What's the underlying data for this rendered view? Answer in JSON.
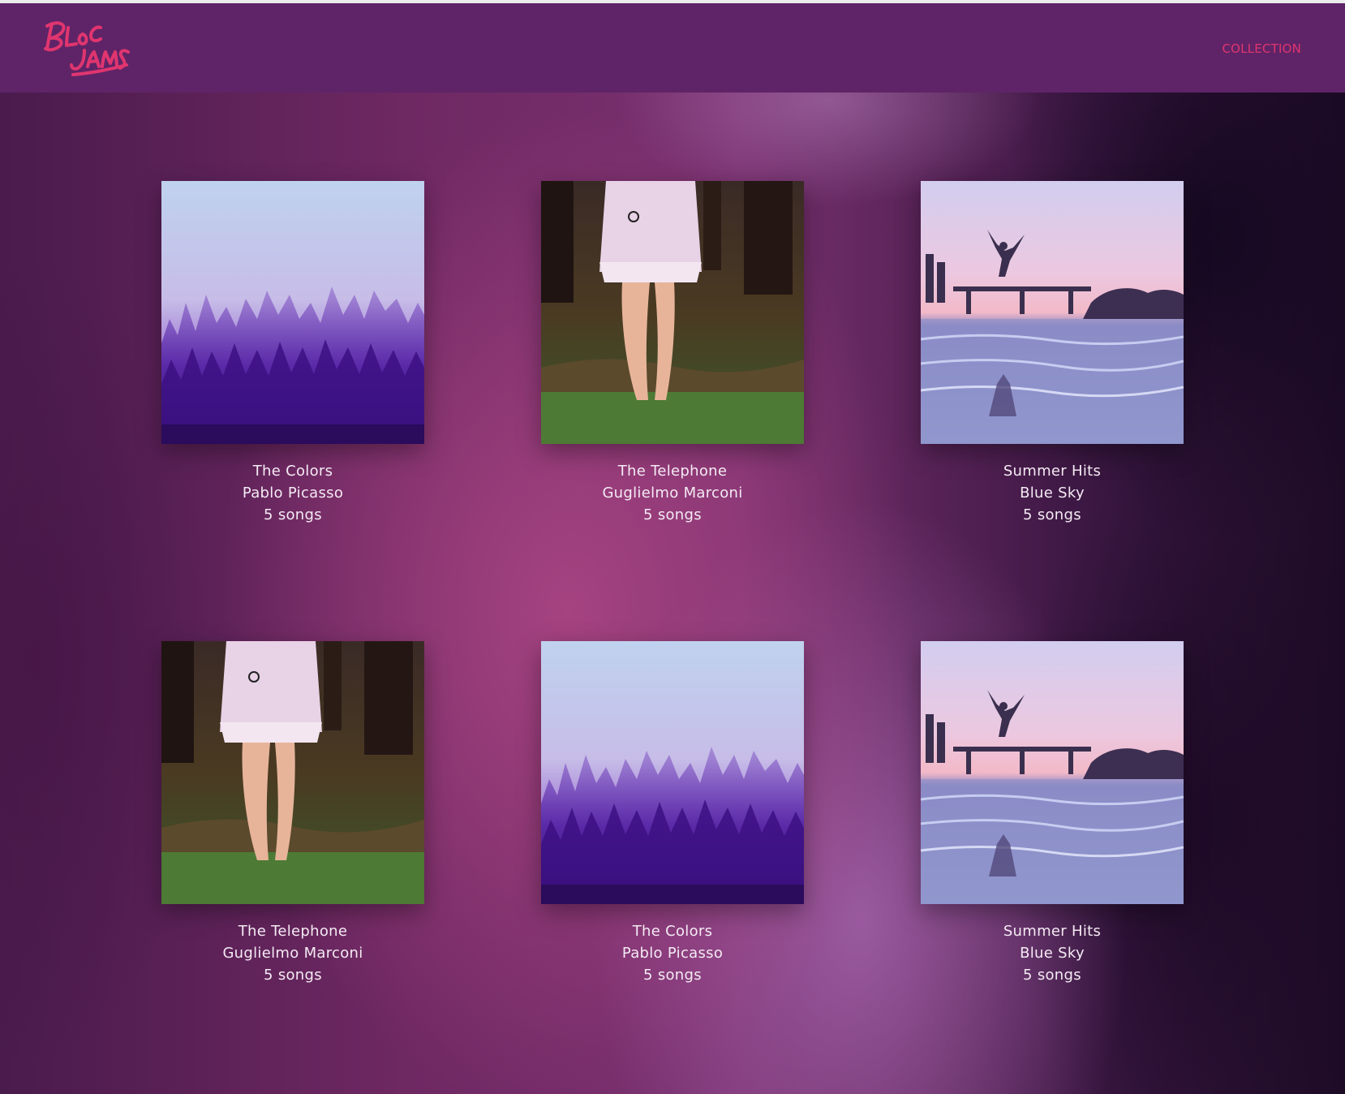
{
  "header": {
    "logo_alt": "Bloc Jams",
    "nav": {
      "collection_label": "COLLECTION"
    }
  },
  "colors": {
    "navbar": "#5f2467",
    "accent": "#e0356f",
    "text": "#f4eaf3"
  },
  "albums": [
    {
      "title": "The Colors",
      "artist": "Pablo Picasso",
      "songs": "5 songs",
      "cover": "foggy-forest-cover"
    },
    {
      "title": "The Telephone",
      "artist": "Guglielmo Marconi",
      "songs": "5 songs",
      "cover": "girl-in-dress-cover"
    },
    {
      "title": "Summer Hits",
      "artist": "Blue Sky",
      "songs": "5 songs",
      "cover": "lake-jump-cover"
    },
    {
      "title": "The Telephone",
      "artist": "Guglielmo Marconi",
      "songs": "5 songs",
      "cover": "girl-in-dress-cover"
    },
    {
      "title": "The Colors",
      "artist": "Pablo Picasso",
      "songs": "5 songs",
      "cover": "foggy-forest-cover"
    },
    {
      "title": "Summer Hits",
      "artist": "Blue Sky",
      "songs": "5 songs",
      "cover": "lake-jump-cover"
    }
  ]
}
